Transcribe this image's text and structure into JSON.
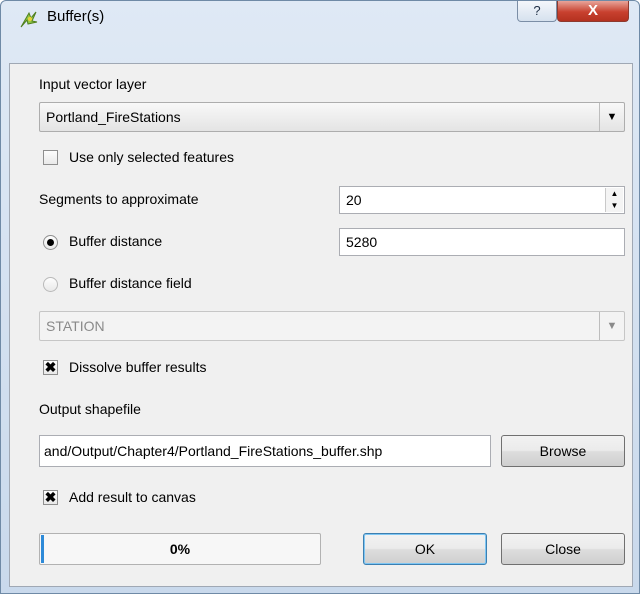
{
  "window": {
    "title": "Buffer(s)",
    "help_glyph": "?",
    "close_glyph": "X"
  },
  "input_layer": {
    "label": "Input vector layer",
    "value": "Portland_FireStations",
    "arrow": "▼"
  },
  "use_selected": {
    "label": "Use only selected features",
    "checked": false,
    "mark": ""
  },
  "segments": {
    "label": "Segments to approximate",
    "value": "20",
    "up": "▲",
    "down": "▼"
  },
  "buffer_distance": {
    "label": "Buffer distance",
    "selected": true,
    "value": "5280"
  },
  "buffer_field": {
    "label": "Buffer distance field",
    "selected": false,
    "value": "STATION",
    "arrow": "▼"
  },
  "dissolve": {
    "label": "Dissolve buffer results",
    "checked": true,
    "mark": "✖"
  },
  "output": {
    "label": "Output shapefile",
    "value": "and/Output/Chapter4/Portland_FireStations_buffer.shp",
    "browse_label": "Browse"
  },
  "add_to_canvas": {
    "label": "Add result to canvas",
    "checked": true,
    "mark": "✖"
  },
  "progress": {
    "percent_text": "0%",
    "fraction": 0.0
  },
  "buttons": {
    "ok": "OK",
    "close": "Close"
  },
  "colors": {
    "progress_fill": "#2e8ad8",
    "title_close": "#c8412f"
  }
}
